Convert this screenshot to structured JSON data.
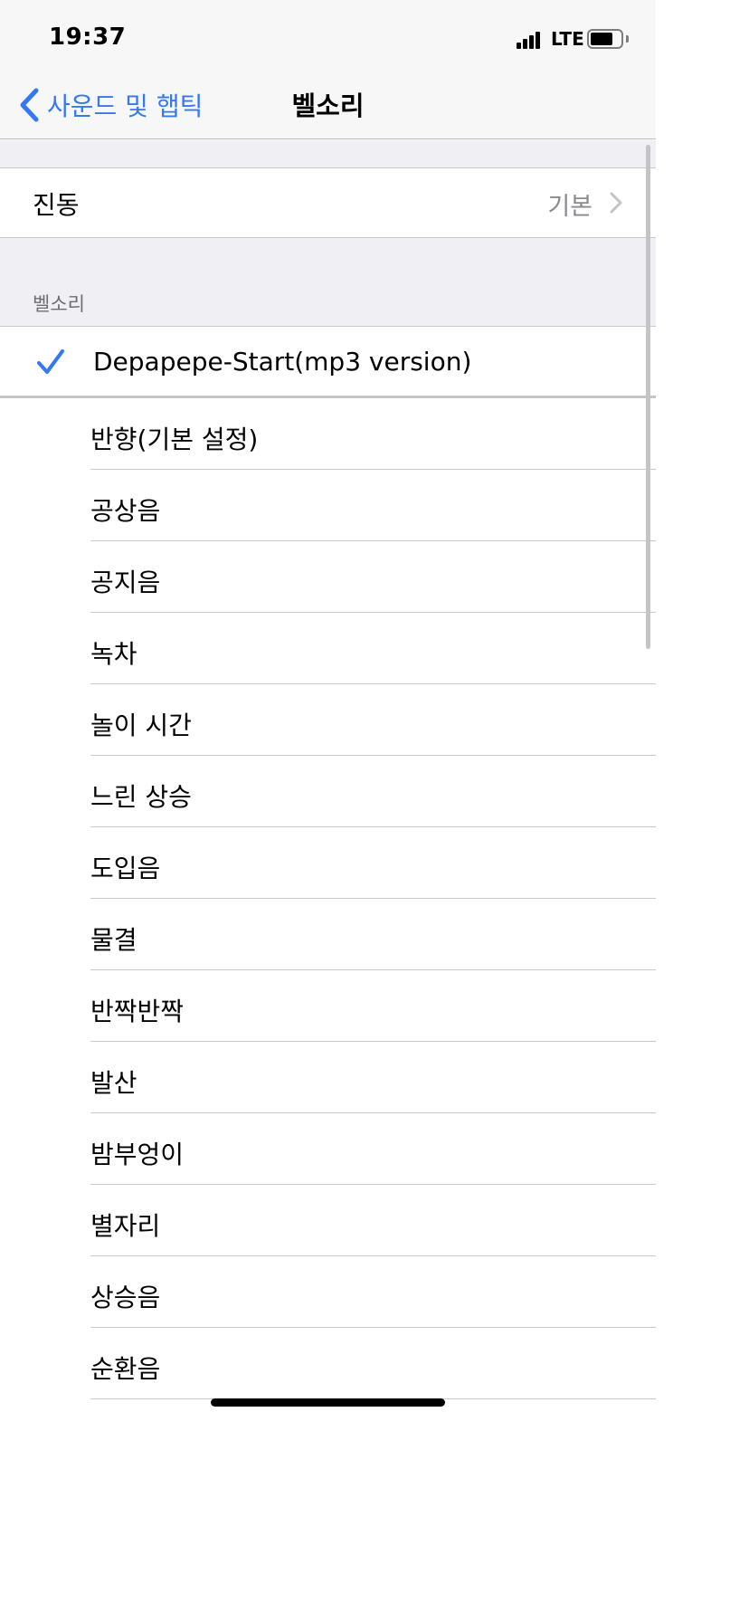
{
  "status_bar": {
    "time": "19:37",
    "network": "LTE"
  },
  "nav": {
    "back_label": "사운드 및 햅틱",
    "title": "벨소리"
  },
  "vibration": {
    "label": "진동",
    "value": "기본"
  },
  "section_header": "벨소리",
  "selected_tone": "Depapepe-Start(mp3 version)",
  "tones": [
    "반향(기본 설정)",
    "공상음",
    "공지음",
    "녹차",
    "놀이 시간",
    "느린 상승",
    "도입음",
    "물결",
    "반짝반짝",
    "발산",
    "밤부엉이",
    "별자리",
    "상승음",
    "순환음"
  ],
  "colors": {
    "accent": "#3478f6",
    "grouped_background": "#efeff4",
    "separator": "#c8c7cc",
    "secondary_text": "#8a8a8e"
  },
  "icons": {
    "back": "chevron-left-icon",
    "disclosure": "chevron-right-icon",
    "selected": "checkmark-icon"
  }
}
